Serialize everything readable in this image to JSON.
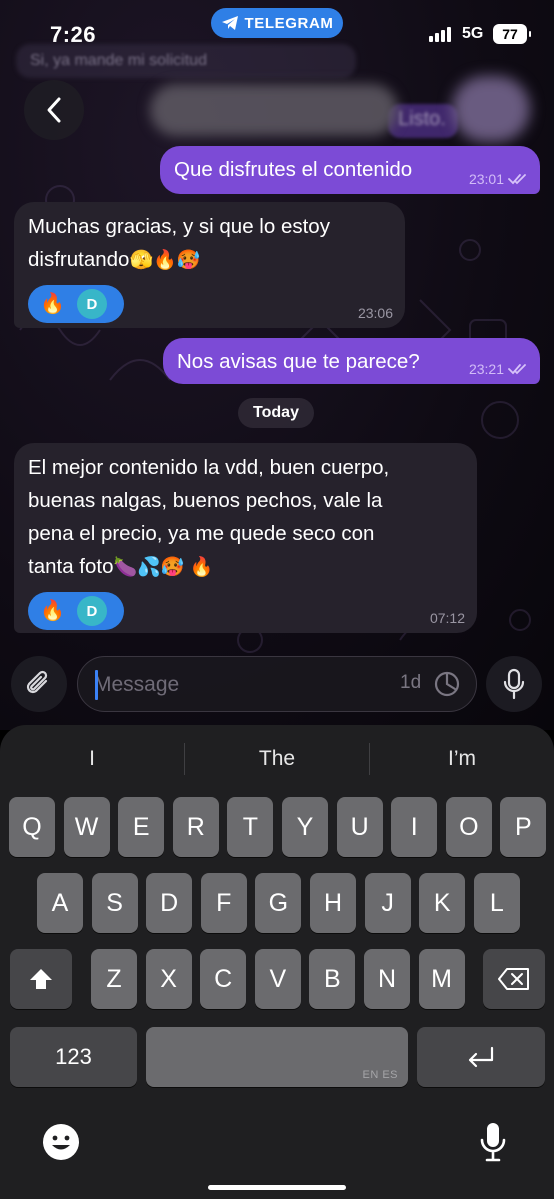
{
  "status_bar": {
    "time": "7:26",
    "app_label": "TELEGRAM",
    "network": "5G",
    "battery": "77"
  },
  "header": {
    "previous_message": "Si, ya mande mi solicitud",
    "ghost_message": "Listo."
  },
  "messages": [
    {
      "direction": "out",
      "text": "Que disfrutes el contenido",
      "time": "23:01"
    },
    {
      "direction": "in",
      "text_line1": "Muchas gracias, y si que lo estoy",
      "text_line2": "disfrutando",
      "emoji": "🫣🔥🥵",
      "time": "23:06",
      "reaction": "🔥",
      "reaction_avatar": "D"
    },
    {
      "direction": "out",
      "text": "Nos avisas que te parece?",
      "time": "23:21"
    },
    {
      "direction": "in",
      "text_line1": "El mejor contenido la vdd, buen cuerpo,",
      "text_line2": "buenas nalgas, buenos pechos, vale la",
      "text_line3": "pena el precio, ya me quede seco con",
      "text_line4": "tanta foto",
      "emoji": "🍆💦🥵 🔥",
      "time": "07:12",
      "reaction": "🔥",
      "reaction_avatar": "D"
    }
  ],
  "date_separator": "Today",
  "composer": {
    "placeholder": "Message",
    "timer_label": "1d"
  },
  "keyboard": {
    "suggestions": [
      "I",
      "The",
      "I’m"
    ],
    "row1": [
      "Q",
      "W",
      "E",
      "R",
      "T",
      "Y",
      "U",
      "I",
      "O",
      "P"
    ],
    "row2": [
      "A",
      "S",
      "D",
      "F",
      "G",
      "H",
      "J",
      "K",
      "L"
    ],
    "row3": [
      "Z",
      "X",
      "C",
      "V",
      "B",
      "N",
      "M"
    ],
    "numbers_label": "123",
    "language_hint": "EN ES"
  },
  "colors": {
    "outgoing_bubble": "#7c4bd6",
    "incoming_bubble": "#26222c",
    "accent": "#2f7fe6"
  },
  "icons": [
    "back-chevron-icon",
    "paperclip-icon",
    "timer-icon",
    "microphone-icon",
    "shift-icon",
    "backspace-icon",
    "return-icon",
    "emoji-icon",
    "dictation-icon",
    "double-check-icon",
    "telegram-icon"
  ]
}
